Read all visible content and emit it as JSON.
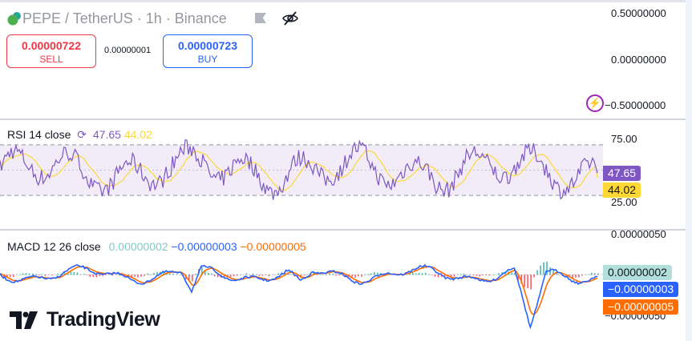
{
  "header": {
    "symbol": "PEPE",
    "title": "PEPE / TetherUS · 1h · Binance",
    "icons": [
      "pepe-logo",
      "flag-icon",
      "eye-off-icon"
    ]
  },
  "trade": {
    "sell_price": "0.00000722",
    "sell_label": "SELL",
    "spread": "0.00000001",
    "buy_price": "0.00000723",
    "buy_label": "BUY"
  },
  "price_axis": [
    "0.50000000",
    "0.00000000",
    "−0.50000000"
  ],
  "rsi": {
    "label": "RSI 14 close",
    "value": "47.65",
    "ma": "44.02",
    "axis": [
      "75.00",
      "25.00"
    ],
    "color": "#7e57c2",
    "ma_color": "#fdd835",
    "band_upper": 70,
    "band_lower": 30
  },
  "macd": {
    "label": "MACD 12 26 close",
    "hist": "0.00000002",
    "macd": "−0.00000003",
    "signal": "−0.00000005",
    "axis": [
      "0.00000050",
      "−0.00000050"
    ],
    "hist_color": "#b2dfdb",
    "macd_color": "#2962ff",
    "signal_color": "#ff6d00"
  },
  "branding": {
    "name": "TradingView"
  }
}
